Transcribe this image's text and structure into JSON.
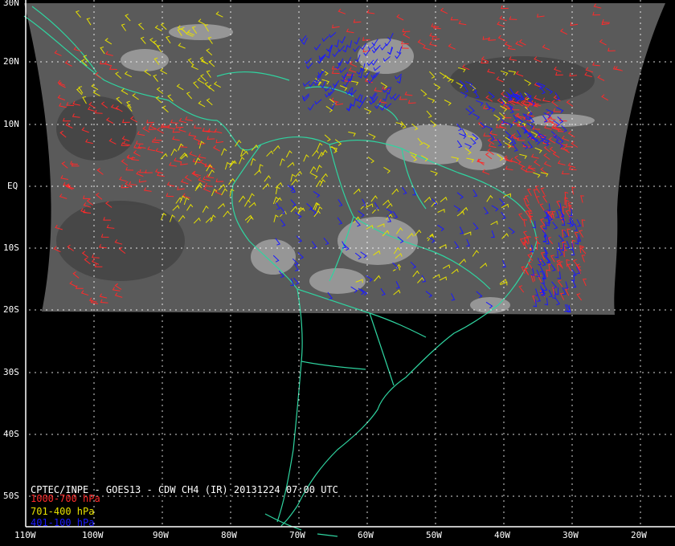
{
  "colors": {
    "background": "#000000",
    "satellite_gray": "#595959",
    "coastline": "#2fd4a0",
    "grid": "#ffffff",
    "low_level": "#ff2a2a",
    "mid_level": "#e6e000",
    "high_level": "#1a1aff",
    "caption": "#ffffff"
  },
  "lat_labels": [
    "30N",
    "20N",
    "10N",
    "EQ",
    "10S",
    "20S",
    "30S",
    "40S",
    "50S"
  ],
  "lon_labels": [
    "110W",
    "100W",
    "90W",
    "80W",
    "70W",
    "60W",
    "50W",
    "40W",
    "30W",
    "20W"
  ],
  "caption": {
    "title": "CPTEC/INPE - GOES13 - CDW CH4 (IR) 20131224 07:00 UTC",
    "legend": [
      {
        "label": "1000-700 hPa",
        "color": "#ff2a2a"
      },
      {
        "label": "701-400 hPa",
        "color": "#e6e000"
      },
      {
        "label": "401-100 hPa",
        "color": "#1a1aff"
      }
    ]
  }
}
